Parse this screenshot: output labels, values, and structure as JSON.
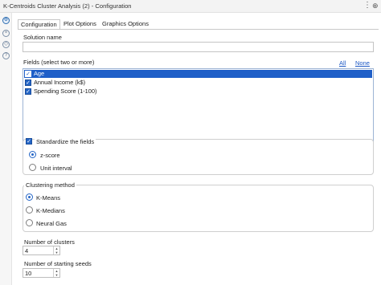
{
  "window": {
    "title": "K-Centroids Cluster Analysis (2) - Configuration",
    "menu_icon": "⋮",
    "pin_icon": "⊕"
  },
  "sidebar": {
    "icons": [
      {
        "name": "gear-icon",
        "glyph": "⚙"
      },
      {
        "name": "close-circle-icon",
        "glyph": "×"
      },
      {
        "name": "tag-icon",
        "glyph": "◇"
      },
      {
        "name": "help-icon",
        "glyph": "?"
      }
    ]
  },
  "tabs": [
    {
      "label": "Configuration",
      "active": true
    },
    {
      "label": "Plot Options",
      "active": false
    },
    {
      "label": "Graphics Options",
      "active": false
    }
  ],
  "solution_name": {
    "label": "Solution name",
    "value": ""
  },
  "fields": {
    "label": "Fields (select two or more)",
    "all_link": "All",
    "none_link": "None",
    "items": [
      {
        "label": "Age",
        "checked": true,
        "selected": true
      },
      {
        "label": "Annual Income (k$)",
        "checked": true,
        "selected": false
      },
      {
        "label": "Spending Score (1-100)",
        "checked": true,
        "selected": false
      }
    ]
  },
  "standardize": {
    "label": "Standardize the fields",
    "checked": true,
    "options": [
      {
        "label": "z-score",
        "checked": true
      },
      {
        "label": "Unit interval",
        "checked": false
      }
    ]
  },
  "clustering": {
    "label": "Clustering method",
    "options": [
      {
        "label": "K-Means",
        "checked": true
      },
      {
        "label": "K-Medians",
        "checked": false
      },
      {
        "label": "Neural Gas",
        "checked": false
      }
    ]
  },
  "num_clusters": {
    "label": "Number of clusters",
    "value": "4"
  },
  "num_seeds": {
    "label": "Number of starting seeds",
    "value": "10"
  },
  "colors": {
    "accent": "#2465c6",
    "selection": "#1f5fc8",
    "link": "#1a56c4"
  }
}
